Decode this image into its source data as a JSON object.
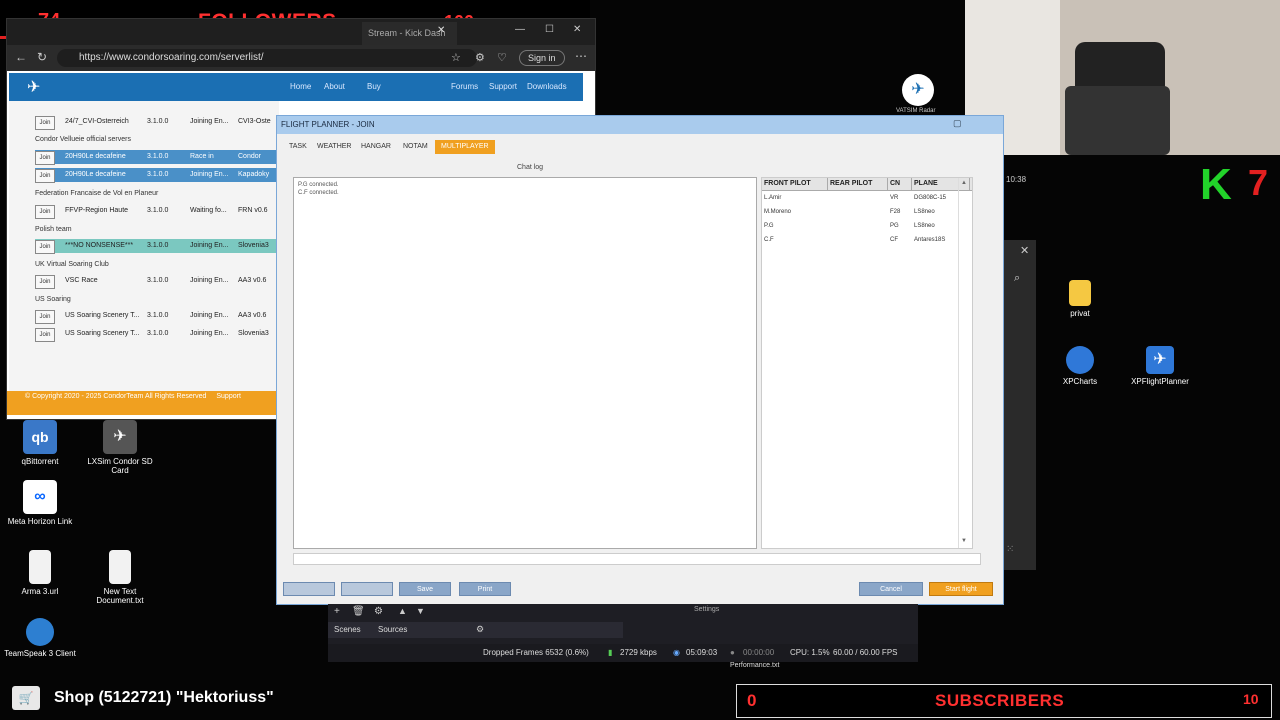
{
  "overlays": {
    "followers": {
      "count": "74",
      "label": "FOLLOWERS",
      "goal": "100"
    },
    "kick": {
      "logo": "K",
      "count": "7"
    },
    "subscribers": {
      "count": "0",
      "label": "SUBSCRIBERS",
      "goal": "10"
    },
    "shop": {
      "text": "Shop (5122721) \"Hektoriuss\""
    }
  },
  "browser": {
    "tab_title": "Stream - Kick Dash",
    "url": "https://www.condorsoaring.com/serverlist/",
    "sign_in": "Sign in",
    "nav": [
      "Home",
      "About",
      "Buy",
      "Forums",
      "Support",
      "Downloads"
    ],
    "server_groups": [
      {
        "group": "Condor Vellueie official servers",
        "rows": [
          {
            "join": "Join",
            "name": "20H90Le decafeine",
            "version": "3.1.0.0",
            "status": "Race in",
            "extra": "Condor",
            "selected": true
          },
          {
            "join": "Join",
            "name": "20H90Le decafeine",
            "version": "3.1.0.0",
            "status": "Joining En...",
            "extra": "Kapadoky",
            "selected": true
          }
        ]
      },
      {
        "group": "Federation Francaise de Vol en Planeur",
        "rows": [
          {
            "join": "Join",
            "name": "FFVP-Region Haute",
            "version": "3.1.0.0",
            "status": "Waiting fo...",
            "extra": "FRN v0.6"
          }
        ]
      },
      {
        "group": "Polish team",
        "rows": [
          {
            "join": "Join",
            "name": "***NO NONSENSE***",
            "version": "3.1.0.0",
            "status": "Joining En...",
            "extra": "Slovenia3",
            "green": true
          }
        ]
      },
      {
        "group": "UK Virtual Soaring Club",
        "rows": [
          {
            "join": "Join",
            "name": "VSC Race",
            "version": "3.1.0.0",
            "status": "Joining En...",
            "extra": "AA3 v0.6"
          }
        ]
      },
      {
        "group": "US Soaring",
        "rows": [
          {
            "join": "Join",
            "name": "US Soaring Scenery T...",
            "version": "3.1.0.0",
            "status": "Joining En...",
            "extra": "AA3 v0.6"
          },
          {
            "join": "Join",
            "name": "US Soaring Scenery T...",
            "version": "3.1.0.0",
            "status": "Joining En...",
            "extra": "Slovenia3"
          }
        ]
      }
    ],
    "top_rows": [
      {
        "join": "Join",
        "name": "24/7_CVI-Osterreich",
        "version": "3.1.0.0",
        "status": "Joining En...",
        "extra": "CVI3-Oste"
      }
    ],
    "footer": "© Copyright 2020 - 2025 CondorTeam All Rights Reserved",
    "footer_link": "Support"
  },
  "desktop_icons": {
    "qbittorrent": "qBittorrent",
    "lxsim": "LXSim Condor SD Card",
    "meta": "Meta Horizon Link",
    "arma": "Arma 3.url",
    "newtext": "New Text Document.txt",
    "teamspeak": "TeamSpeak 3 Client",
    "privat": "privat",
    "xpcharts": "XPCharts",
    "xpflightplanner": "XPFlightPlanner",
    "vatsim": "VATSIM Radar",
    "performance": "Performance.txt"
  },
  "dialog": {
    "title": "FLIGHT PLANNER - JOIN",
    "tabs": [
      "TASK",
      "WEATHER",
      "HANGAR",
      "NOTAM",
      "MULTIPLAYER"
    ],
    "active_tab": "MULTIPLAYER",
    "chat_caption": "Chat log",
    "chat_lines": [
      "P.G connected.",
      "C.F connected."
    ],
    "columns": [
      "FRONT PILOT",
      "REAR PILOT",
      "CN",
      "PLANE"
    ],
    "pilots": [
      {
        "front": "L.Amir",
        "rear": "",
        "cn": "VR",
        "plane": "DG808C-15"
      },
      {
        "front": "M.Moreno",
        "rear": "",
        "cn": "F28",
        "plane": "LS8neo"
      },
      {
        "front": "P.G",
        "rear": "",
        "cn": "PG",
        "plane": "LS8neo"
      },
      {
        "front": "C.F",
        "rear": "",
        "cn": "CF",
        "plane": "Antares18S"
      }
    ],
    "buttons": {
      "save": "Save",
      "print": "Print",
      "cancel": "Cancel",
      "fly": "Start flight"
    }
  },
  "obs": {
    "tabs": [
      "Scenes",
      "Sources"
    ],
    "settings": "Settings",
    "dropped": "Dropped Frames 6532 (0.6%)",
    "bitrate": "2729 kbps",
    "rec_time": "05:09:03",
    "stream_time": "00:00:00",
    "cpu": "CPU: 1.5%",
    "fps": "60.00 / 60.00 FPS"
  },
  "clock": "10:38",
  "colors": {
    "overlay_red": "#ff3030",
    "kick_green": "#22d32a",
    "accent_orange": "#f0a020",
    "condor_blue": "#1b6fb3"
  }
}
